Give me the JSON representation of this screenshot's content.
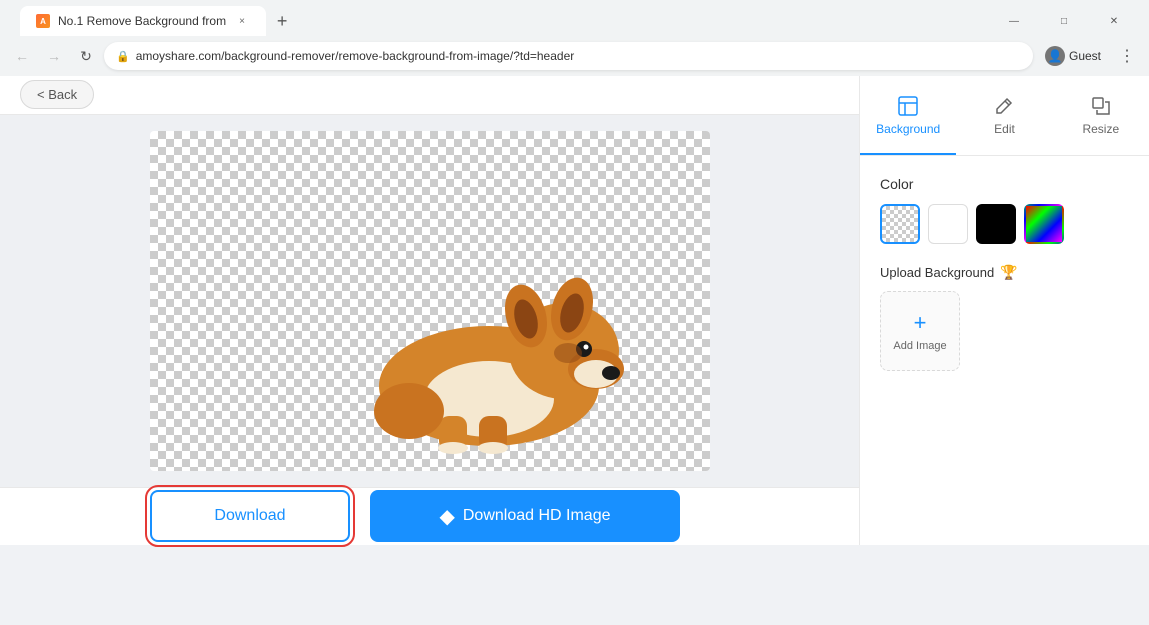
{
  "browser": {
    "tab": {
      "favicon_label": "A",
      "title": "No.1 Remove Background from ",
      "close_icon": "×"
    },
    "new_tab_icon": "+",
    "window_controls": {
      "minimize": "—",
      "maximize": "□",
      "close": "✕"
    },
    "nav": {
      "back": "←",
      "forward": "→",
      "refresh": "↻"
    },
    "address": "amoyshare.com/background-remover/remove-background-from-image/?td=header",
    "profile_label": "Guest",
    "menu_icon": "⋮"
  },
  "header": {
    "back_label": "< Back"
  },
  "panel": {
    "tabs": [
      {
        "label": "Background",
        "active": true
      },
      {
        "label": "Edit",
        "active": false
      },
      {
        "label": "Resize",
        "active": false
      }
    ],
    "color_section_label": "Color",
    "swatches": [
      {
        "type": "transparent",
        "selected": true
      },
      {
        "type": "white",
        "selected": false
      },
      {
        "type": "black",
        "selected": false
      },
      {
        "type": "gradient",
        "selected": false
      }
    ],
    "upload_bg_label": "Upload Background",
    "add_image_label": "Add Image"
  },
  "bottom_bar": {
    "download_label": "Download",
    "download_hd_label": "Download HD Image",
    "diamond_icon": "◆"
  }
}
